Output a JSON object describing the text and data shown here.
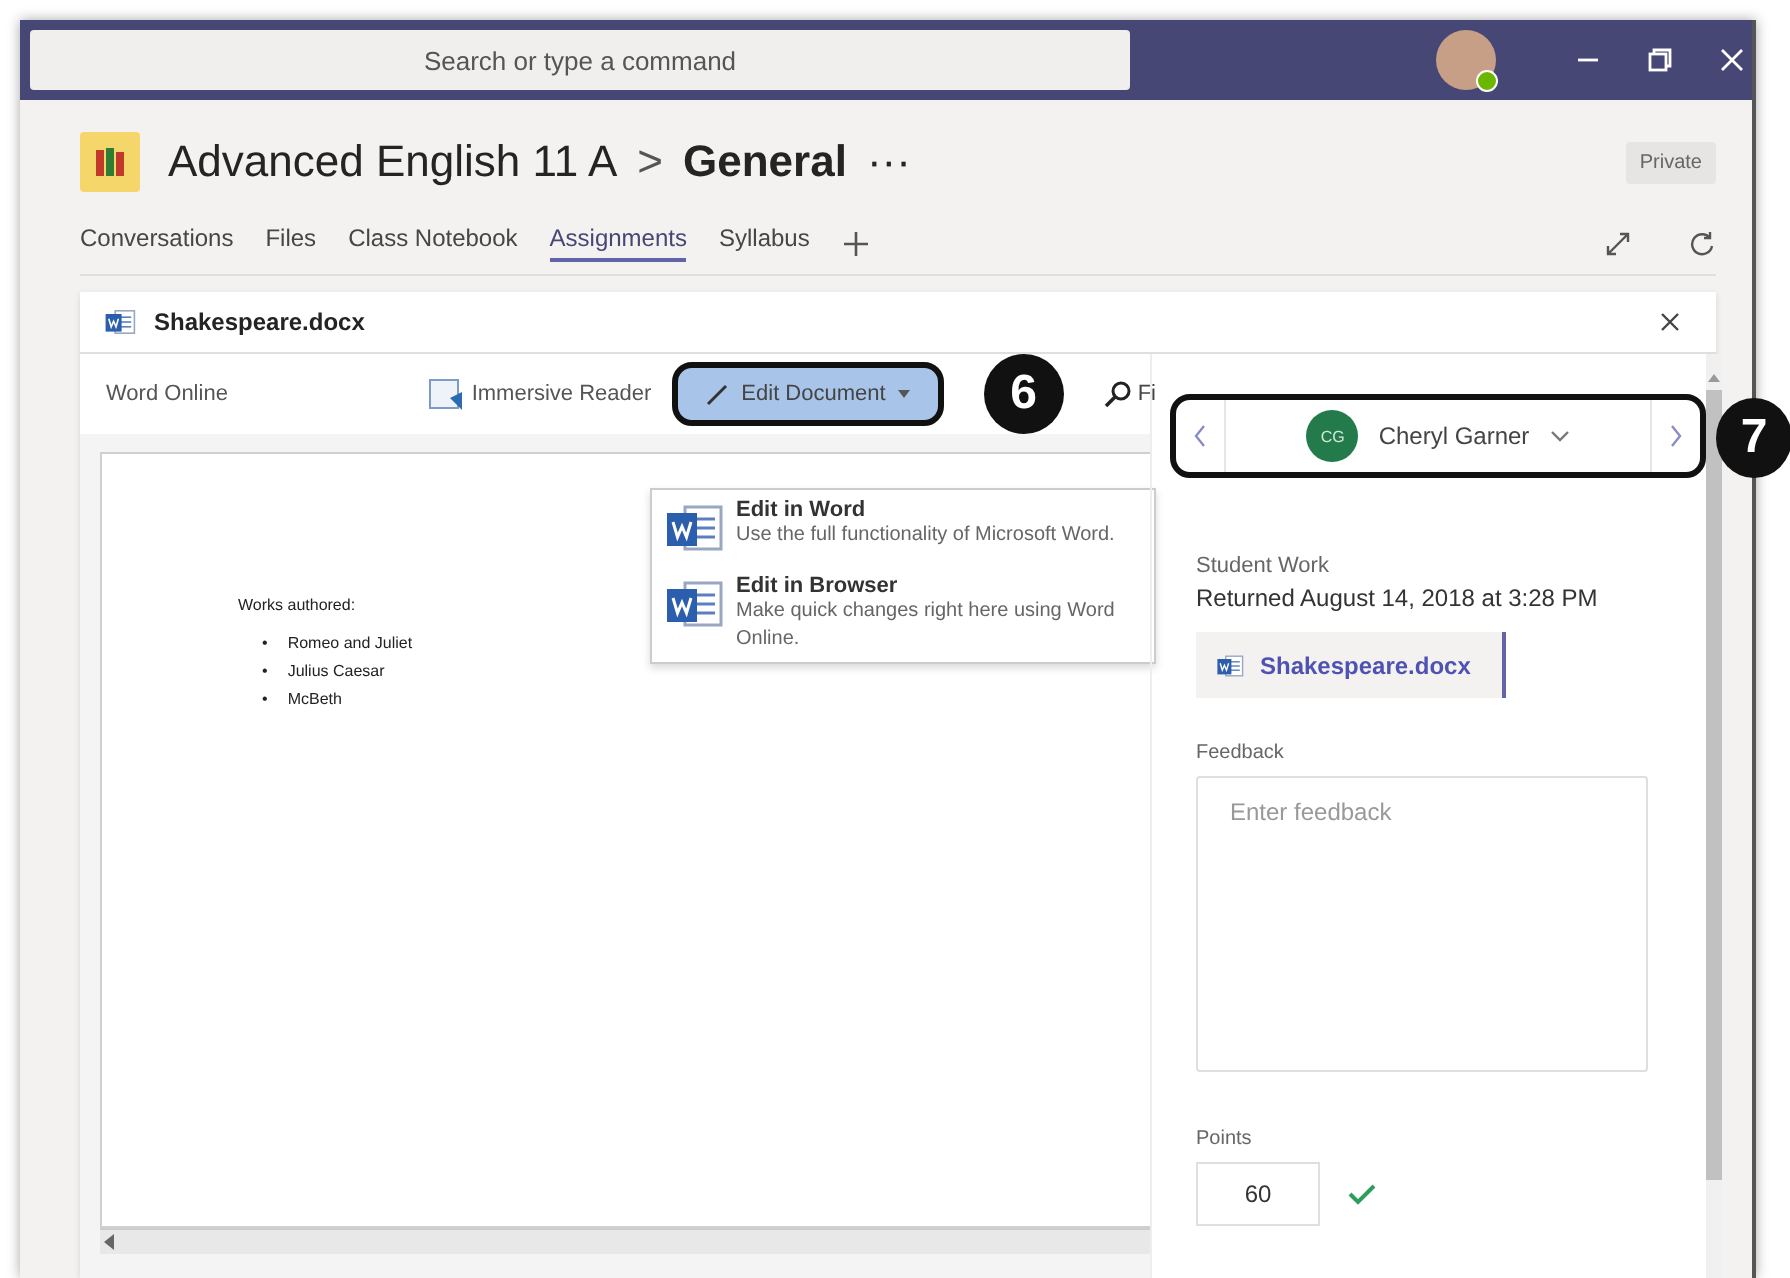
{
  "title_bar": {
    "search_placeholder": "Search or type a command"
  },
  "channel": {
    "team": "Advanced English 11 A",
    "separator": ">",
    "name": "General",
    "more": "···",
    "privacy": "Private"
  },
  "tabs": [
    {
      "label": "Conversations",
      "selected": false
    },
    {
      "label": "Files",
      "selected": false
    },
    {
      "label": "Class Notebook",
      "selected": false
    },
    {
      "label": "Assignments",
      "selected": true
    },
    {
      "label": "Syllabus",
      "selected": false
    }
  ],
  "document": {
    "file_name": "Shakespeare.docx",
    "app": "Word Online",
    "immersive_reader": "Immersive Reader",
    "edit_button": "Edit Document",
    "find": "Fi",
    "menu": [
      {
        "title": "Edit in Word",
        "description": "Use the full functionality of Microsoft Word."
      },
      {
        "title": "Edit in Browser",
        "description": "Make quick changes right here using Word Online."
      }
    ],
    "page": {
      "heading": "Works authored:",
      "items": [
        {
          "bullet": "•",
          "text": "Romeo and Juliet"
        },
        {
          "bullet": "•",
          "text": "Julius Caesar"
        },
        {
          "bullet": "•",
          "text": "McBeth"
        }
      ]
    }
  },
  "review": {
    "student": {
      "initials": "CG",
      "name": "Cheryl Garner"
    },
    "section_label": "Student Work",
    "status": "Returned August 14, 2018 at 3:28 PM",
    "attachment": "Shakespeare.docx",
    "feedback": {
      "label": "Feedback",
      "placeholder": "Enter feedback"
    },
    "points": {
      "label": "Points",
      "value": "60"
    }
  },
  "callouts": [
    "6",
    "7"
  ]
}
